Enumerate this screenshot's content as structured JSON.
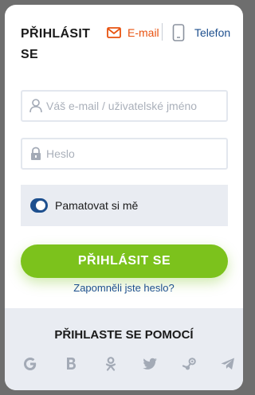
{
  "login": {
    "title": "PŘIHLÁSIT SE",
    "tabs": {
      "email_label": "E-mail",
      "phone_label": "Telefon"
    },
    "email_placeholder": "Váš e-mail / uživatelské jméno",
    "password_placeholder": "Heslo",
    "remember_label": "Pamatovat si mě",
    "remember_checked": true,
    "submit_label": "PŘIHLÁSIT SE",
    "forgot_label": "Zapomněli jste heslo?"
  },
  "social": {
    "heading": "PŘIHLASTE SE POMOCÍ",
    "icons": [
      "google-icon",
      "b-icon",
      "odnoklassniki-icon",
      "twitter-icon",
      "steam-icon",
      "telegram-icon"
    ]
  },
  "colors": {
    "accent_green": "#7cc21c",
    "brand_blue": "#1d4f8e",
    "active_orange": "#e8520f"
  }
}
